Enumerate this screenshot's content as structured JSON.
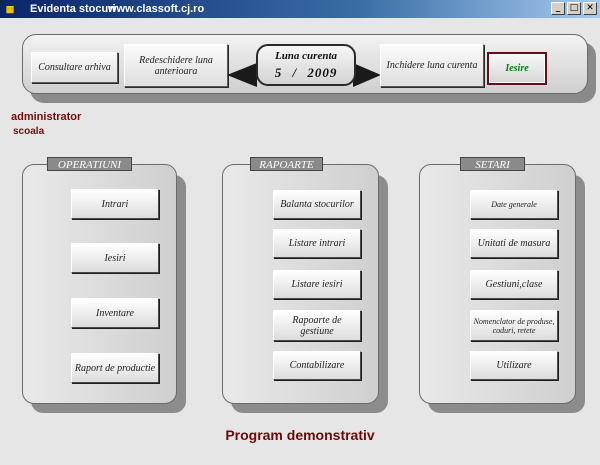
{
  "window": {
    "title": "Evidenta stocuri",
    "url": "www.classoft.cj.ro",
    "minimize_glyph": "_",
    "maximize_glyph": "□",
    "close_glyph": "✕"
  },
  "toolbar": {
    "archive_label": "Consultare arhiva",
    "reopen_label": "Redeschidere luna anterioara",
    "current_label": "Luna curenta",
    "current_month": "5",
    "current_sep": "/",
    "current_year": "2009",
    "close_month_label": "Inchidere luna curenta",
    "exit_label": "Iesire"
  },
  "user": {
    "name": "administrator",
    "group": "scoala"
  },
  "operatiuni": {
    "title": "OPERATIUNI",
    "items": [
      "Intrari",
      "Iesiri",
      "Inventare",
      "Raport de productie"
    ]
  },
  "rapoarte": {
    "title": "RAPOARTE",
    "items": [
      "Balanta stocurilor",
      "Listare intrari",
      "Listare iesiri",
      "Rapoarte de gestiune",
      "Contabilizare"
    ]
  },
  "setari": {
    "title": "SETARI",
    "items": [
      "Date generale",
      "Unitati de masura",
      "Gestiuni,clase",
      "Nomenclator de produse, coduri, retete",
      "Utilizare"
    ]
  },
  "footer": "Program demonstrativ",
  "colors": {
    "accent_dark_red": "#6b0a0a",
    "exit_green": "#0a7a0a",
    "titlebar_blue": "#0a246a"
  }
}
